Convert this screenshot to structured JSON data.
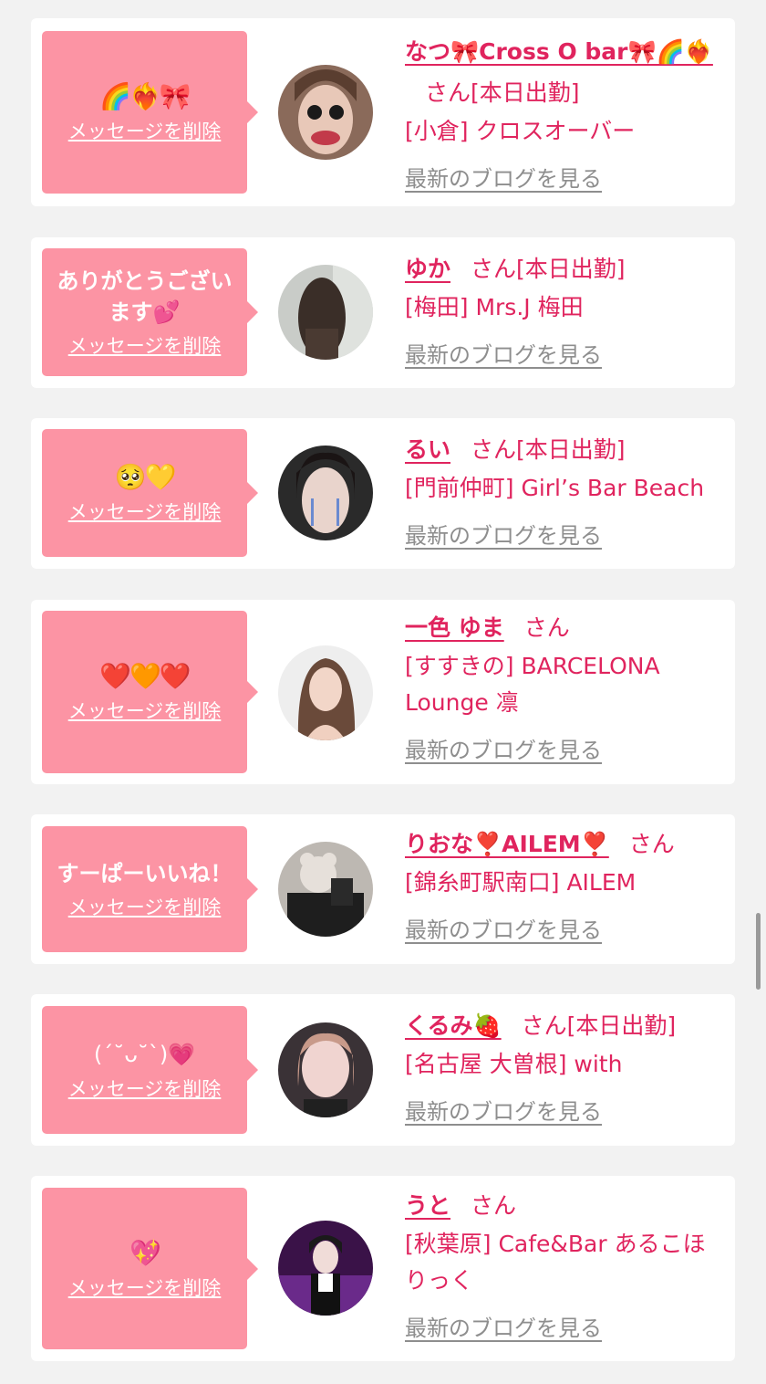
{
  "delete_label": "メッセージを削除",
  "blog_label": "最新のブログを見る",
  "san_label": "さん",
  "colors": {
    "bubble": "#fc94a4",
    "accent": "#e0245e",
    "link_gray": "#8e8e8e",
    "background": "#f2f2f2"
  },
  "items": [
    {
      "message": "🌈❤️‍🔥🎀",
      "name": "なつ🎀Cross O bar🎀🌈❤️‍🔥",
      "status": "[本日出勤]",
      "shop": "[小倉] クロスオーバー"
    },
    {
      "message": "ありがとうございます💕",
      "name": "ゆか",
      "status": "[本日出勤]",
      "shop": "[梅田] Mrs.J 梅田"
    },
    {
      "message": "🥺💛",
      "name": "るい",
      "status": "[本日出勤]",
      "shop": "[門前仲町] Girl’s Bar Beach"
    },
    {
      "message": "❤️🧡❤️",
      "name": "一色 ゆま",
      "status": "",
      "shop": "[すすきの] BARCELONA Lounge 凛"
    },
    {
      "message": "すーぱーいいね！",
      "name": "りおな❣️AILEM❣️",
      "status": "",
      "shop": "[錦糸町駅南口] AILEM"
    },
    {
      "message": "(ˊ˘ᴗ˘ˋ)💗",
      "name": "くるみ🍓",
      "status": "[本日出勤]",
      "shop": "[名古屋 大曽根] with"
    },
    {
      "message": "💖",
      "name": "うと",
      "status": "",
      "shop": "[秋葉原] Cafe&Bar あるこほりっく"
    }
  ]
}
